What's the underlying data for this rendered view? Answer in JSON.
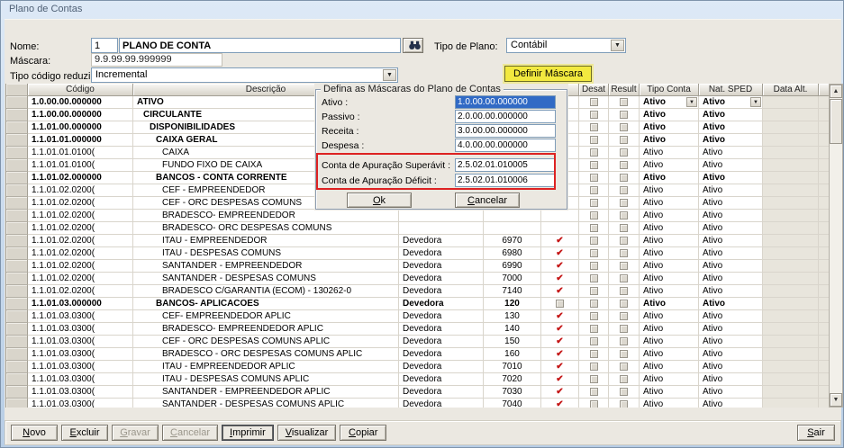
{
  "window": {
    "title": "Plano de Contas"
  },
  "colors": {
    "selection_blue": "#316AC5",
    "highlight_yellow": "#F2E93F",
    "annotation_red": "#DD2222",
    "check_red": "#C41414"
  },
  "form": {
    "nome_label": "Nome:",
    "nome_numero": "1",
    "nome_valor": "PLANO DE CONTA",
    "tipo_plano_label": "Tipo de Plano:",
    "tipo_plano_valor": "Contábil",
    "mascara_label": "Máscara:",
    "mascara_valor": "9.9.99.99.999999",
    "tipo_codigo_label": "Tipo código reduzido:",
    "tipo_codigo_valor": "Incremental",
    "definir_mascara_label": "Definir Máscara"
  },
  "dialog": {
    "title": "Defina as Máscaras do Plano de Contas",
    "fields": [
      {
        "name": "ativo",
        "label": "Ativo :",
        "value": "1.0.00.00.000000",
        "selected": true
      },
      {
        "name": "passivo",
        "label": "Passivo :",
        "value": "2.0.00.00.000000"
      },
      {
        "name": "receita",
        "label": "Receita :",
        "value": "3.0.00.00.000000"
      },
      {
        "name": "despesa",
        "label": "Despesa :",
        "value": "4.0.00.00.000000"
      },
      {
        "name": "apuracao-superavit",
        "label": "Conta de Apuração Superávit :",
        "value": "2.5.02.01.010005",
        "highlighted": true
      },
      {
        "name": "apuracao-deficit",
        "label": "Conta de Apuração Déficit :",
        "value": "2.5.02.01.010006",
        "highlighted": true
      }
    ],
    "ok_label": "Ok",
    "cancel_label": "Cancelar"
  },
  "grid": {
    "columns": [
      {
        "key": "sel",
        "label": ""
      },
      {
        "key": "codigo",
        "label": "Código"
      },
      {
        "key": "descricao",
        "label": "Descrição"
      },
      {
        "key": "natureza",
        "label": ""
      },
      {
        "key": "reduzido",
        "label": ""
      },
      {
        "key": "check",
        "label": ""
      },
      {
        "key": "desat",
        "label": "Desat"
      },
      {
        "key": "result",
        "label": "Result"
      },
      {
        "key": "tipo",
        "label": "Tipo Conta"
      },
      {
        "key": "sped",
        "label": "Nat. SPED"
      },
      {
        "key": "data_alt",
        "label": "Data Alt."
      },
      {
        "key": "filler",
        "label": ""
      }
    ],
    "rows": [
      {
        "codigo": "1.0.00.00.000000",
        "descricao": "ATIVO",
        "level": 0,
        "bold": true,
        "natureza": "",
        "reduzido": "",
        "check": "",
        "tipo_conta": "Ativo",
        "nat_sped": "Ativo",
        "combo": true
      },
      {
        "codigo": "1.1.00.00.000000",
        "descricao": "CIRCULANTE",
        "level": 1,
        "bold": true,
        "natureza": "",
        "reduzido": "",
        "check": "",
        "tipo_conta": "Ativo",
        "nat_sped": "Ativo"
      },
      {
        "codigo": "1.1.01.00.000000",
        "descricao": "DISPONIBILIDADES",
        "level": 2,
        "bold": true,
        "natureza": "",
        "reduzido": "",
        "check": "",
        "tipo_conta": "Ativo",
        "nat_sped": "Ativo"
      },
      {
        "codigo": "1.1.01.01.000000",
        "descricao": "CAIXA GERAL",
        "level": 3,
        "bold": true,
        "natureza": "",
        "reduzido": "",
        "check": "",
        "tipo_conta": "Ativo",
        "nat_sped": "Ativo"
      },
      {
        "codigo": "1.1.01.01.0100(",
        "descricao": "CAIXA",
        "level": 4,
        "bold": false,
        "natureza": "",
        "reduzido": "",
        "check": "",
        "tipo_conta": "Ativo",
        "nat_sped": "Ativo"
      },
      {
        "codigo": "1.1.01.01.0100(",
        "descricao": "FUNDO FIXO DE CAIXA",
        "level": 4,
        "bold": false,
        "natureza": "",
        "reduzido": "",
        "check": "",
        "tipo_conta": "Ativo",
        "nat_sped": "Ativo"
      },
      {
        "codigo": "1.1.01.02.000000",
        "descricao": "BANCOS - CONTA CORRENTE",
        "level": 3,
        "bold": true,
        "natureza": "",
        "reduzido": "",
        "check": "",
        "tipo_conta": "Ativo",
        "nat_sped": "Ativo"
      },
      {
        "codigo": "1.1.01.02.0200(",
        "descricao": "CEF - EMPREENDEDOR",
        "level": 4,
        "bold": false,
        "natureza": "",
        "reduzido": "",
        "check": "",
        "tipo_conta": "Ativo",
        "nat_sped": "Ativo"
      },
      {
        "codigo": "1.1.01.02.0200(",
        "descricao": "CEF - ORC DESPESAS COMUNS",
        "level": 4,
        "bold": false,
        "natureza": "",
        "reduzido": "",
        "check": "",
        "tipo_conta": "Ativo",
        "nat_sped": "Ativo"
      },
      {
        "codigo": "1.1.01.02.0200(",
        "descricao": "BRADESCO- EMPREENDEDOR",
        "level": 4,
        "bold": false,
        "natureza": "",
        "reduzido": "",
        "check": "",
        "tipo_conta": "Ativo",
        "nat_sped": "Ativo"
      },
      {
        "codigo": "1.1.01.02.0200(",
        "descricao": "BRADESCO- ORC DESPESAS COMUNS",
        "level": 4,
        "bold": false,
        "natureza": "",
        "reduzido": "",
        "check": "",
        "tipo_conta": "Ativo",
        "nat_sped": "Ativo"
      },
      {
        "codigo": "1.1.01.02.0200(",
        "descricao": "ITAU - EMPREENDEDOR",
        "level": 4,
        "bold": false,
        "natureza": "Devedora",
        "reduzido": "6970",
        "check": "check",
        "tipo_conta": "Ativo",
        "nat_sped": "Ativo"
      },
      {
        "codigo": "1.1.01.02.0200(",
        "descricao": "ITAU - DESPESAS COMUNS",
        "level": 4,
        "bold": false,
        "natureza": "Devedora",
        "reduzido": "6980",
        "check": "check",
        "tipo_conta": "Ativo",
        "nat_sped": "Ativo"
      },
      {
        "codigo": "1.1.01.02.0200(",
        "descricao": "SANTANDER - EMPREENDEDOR",
        "level": 4,
        "bold": false,
        "natureza": "Devedora",
        "reduzido": "6990",
        "check": "check",
        "tipo_conta": "Ativo",
        "nat_sped": "Ativo"
      },
      {
        "codigo": "1.1.01.02.0200(",
        "descricao": "SANTANDER - DESPESAS COMUNS",
        "level": 4,
        "bold": false,
        "natureza": "Devedora",
        "reduzido": "7000",
        "check": "check",
        "tipo_conta": "Ativo",
        "nat_sped": "Ativo"
      },
      {
        "codigo": "1.1.01.02.0200(",
        "descricao": "BRADESCO C/GARANTIA (ECOM) - 130262-0",
        "level": 4,
        "bold": false,
        "natureza": "Devedora",
        "reduzido": "7140",
        "check": "check",
        "tipo_conta": "Ativo",
        "nat_sped": "Ativo"
      },
      {
        "codigo": "1.1.01.03.000000",
        "descricao": "BANCOS- APLICACOES",
        "level": 3,
        "bold": true,
        "natureza": "Devedora",
        "reduzido": "120",
        "check": "box",
        "tipo_conta": "Ativo",
        "nat_sped": "Ativo"
      },
      {
        "codigo": "1.1.01.03.0300(",
        "descricao": "CEF- EMPREENDEDOR APLIC",
        "level": 4,
        "bold": false,
        "natureza": "Devedora",
        "reduzido": "130",
        "check": "check",
        "tipo_conta": "Ativo",
        "nat_sped": "Ativo"
      },
      {
        "codigo": "1.1.01.03.0300(",
        "descricao": "BRADESCO- EMPREENDEDOR APLIC",
        "level": 4,
        "bold": false,
        "natureza": "Devedora",
        "reduzido": "140",
        "check": "check",
        "tipo_conta": "Ativo",
        "nat_sped": "Ativo"
      },
      {
        "codigo": "1.1.01.03.0300(",
        "descricao": "CEF - ORC DESPESAS COMUNS APLIC",
        "level": 4,
        "bold": false,
        "natureza": "Devedora",
        "reduzido": "150",
        "check": "check",
        "tipo_conta": "Ativo",
        "nat_sped": "Ativo"
      },
      {
        "codigo": "1.1.01.03.0300(",
        "descricao": "BRADESCO - ORC DESPESAS COMUNS APLIC",
        "level": 4,
        "bold": false,
        "natureza": "Devedora",
        "reduzido": "160",
        "check": "check",
        "tipo_conta": "Ativo",
        "nat_sped": "Ativo"
      },
      {
        "codigo": "1.1.01.03.0300(",
        "descricao": "ITAU - EMPREENDEDOR APLIC",
        "level": 4,
        "bold": false,
        "natureza": "Devedora",
        "reduzido": "7010",
        "check": "check",
        "tipo_conta": "Ativo",
        "nat_sped": "Ativo"
      },
      {
        "codigo": "1.1.01.03.0300(",
        "descricao": "ITAU - DESPESAS COMUNS APLIC",
        "level": 4,
        "bold": false,
        "natureza": "Devedora",
        "reduzido": "7020",
        "check": "check",
        "tipo_conta": "Ativo",
        "nat_sped": "Ativo"
      },
      {
        "codigo": "1.1.01.03.0300(",
        "descricao": "SANTANDER - EMPREENDEDOR APLIC",
        "level": 4,
        "bold": false,
        "natureza": "Devedora",
        "reduzido": "7030",
        "check": "check",
        "tipo_conta": "Ativo",
        "nat_sped": "Ativo"
      },
      {
        "codigo": "1.1.01.03.0300(",
        "descricao": "SANTANDER - DESPESAS COMUNS APLIC",
        "level": 4,
        "bold": false,
        "natureza": "Devedora",
        "reduzido": "7040",
        "check": "check",
        "tipo_conta": "Ativo",
        "nat_sped": "Ativo"
      }
    ]
  },
  "toolbar": {
    "buttons": [
      {
        "name": "novo",
        "label": "Novo"
      },
      {
        "name": "excluir",
        "label": "Excluir"
      },
      {
        "name": "gravar",
        "label": "Gravar",
        "disabled": true
      },
      {
        "name": "cancelar",
        "label": "Cancelar",
        "disabled": true
      },
      {
        "name": "imprimir",
        "label": "Imprimir",
        "default_button": true
      },
      {
        "name": "visualizar",
        "label": "Visualizar"
      },
      {
        "name": "copiar",
        "label": "Copiar"
      }
    ],
    "sair_label": "Sair"
  }
}
